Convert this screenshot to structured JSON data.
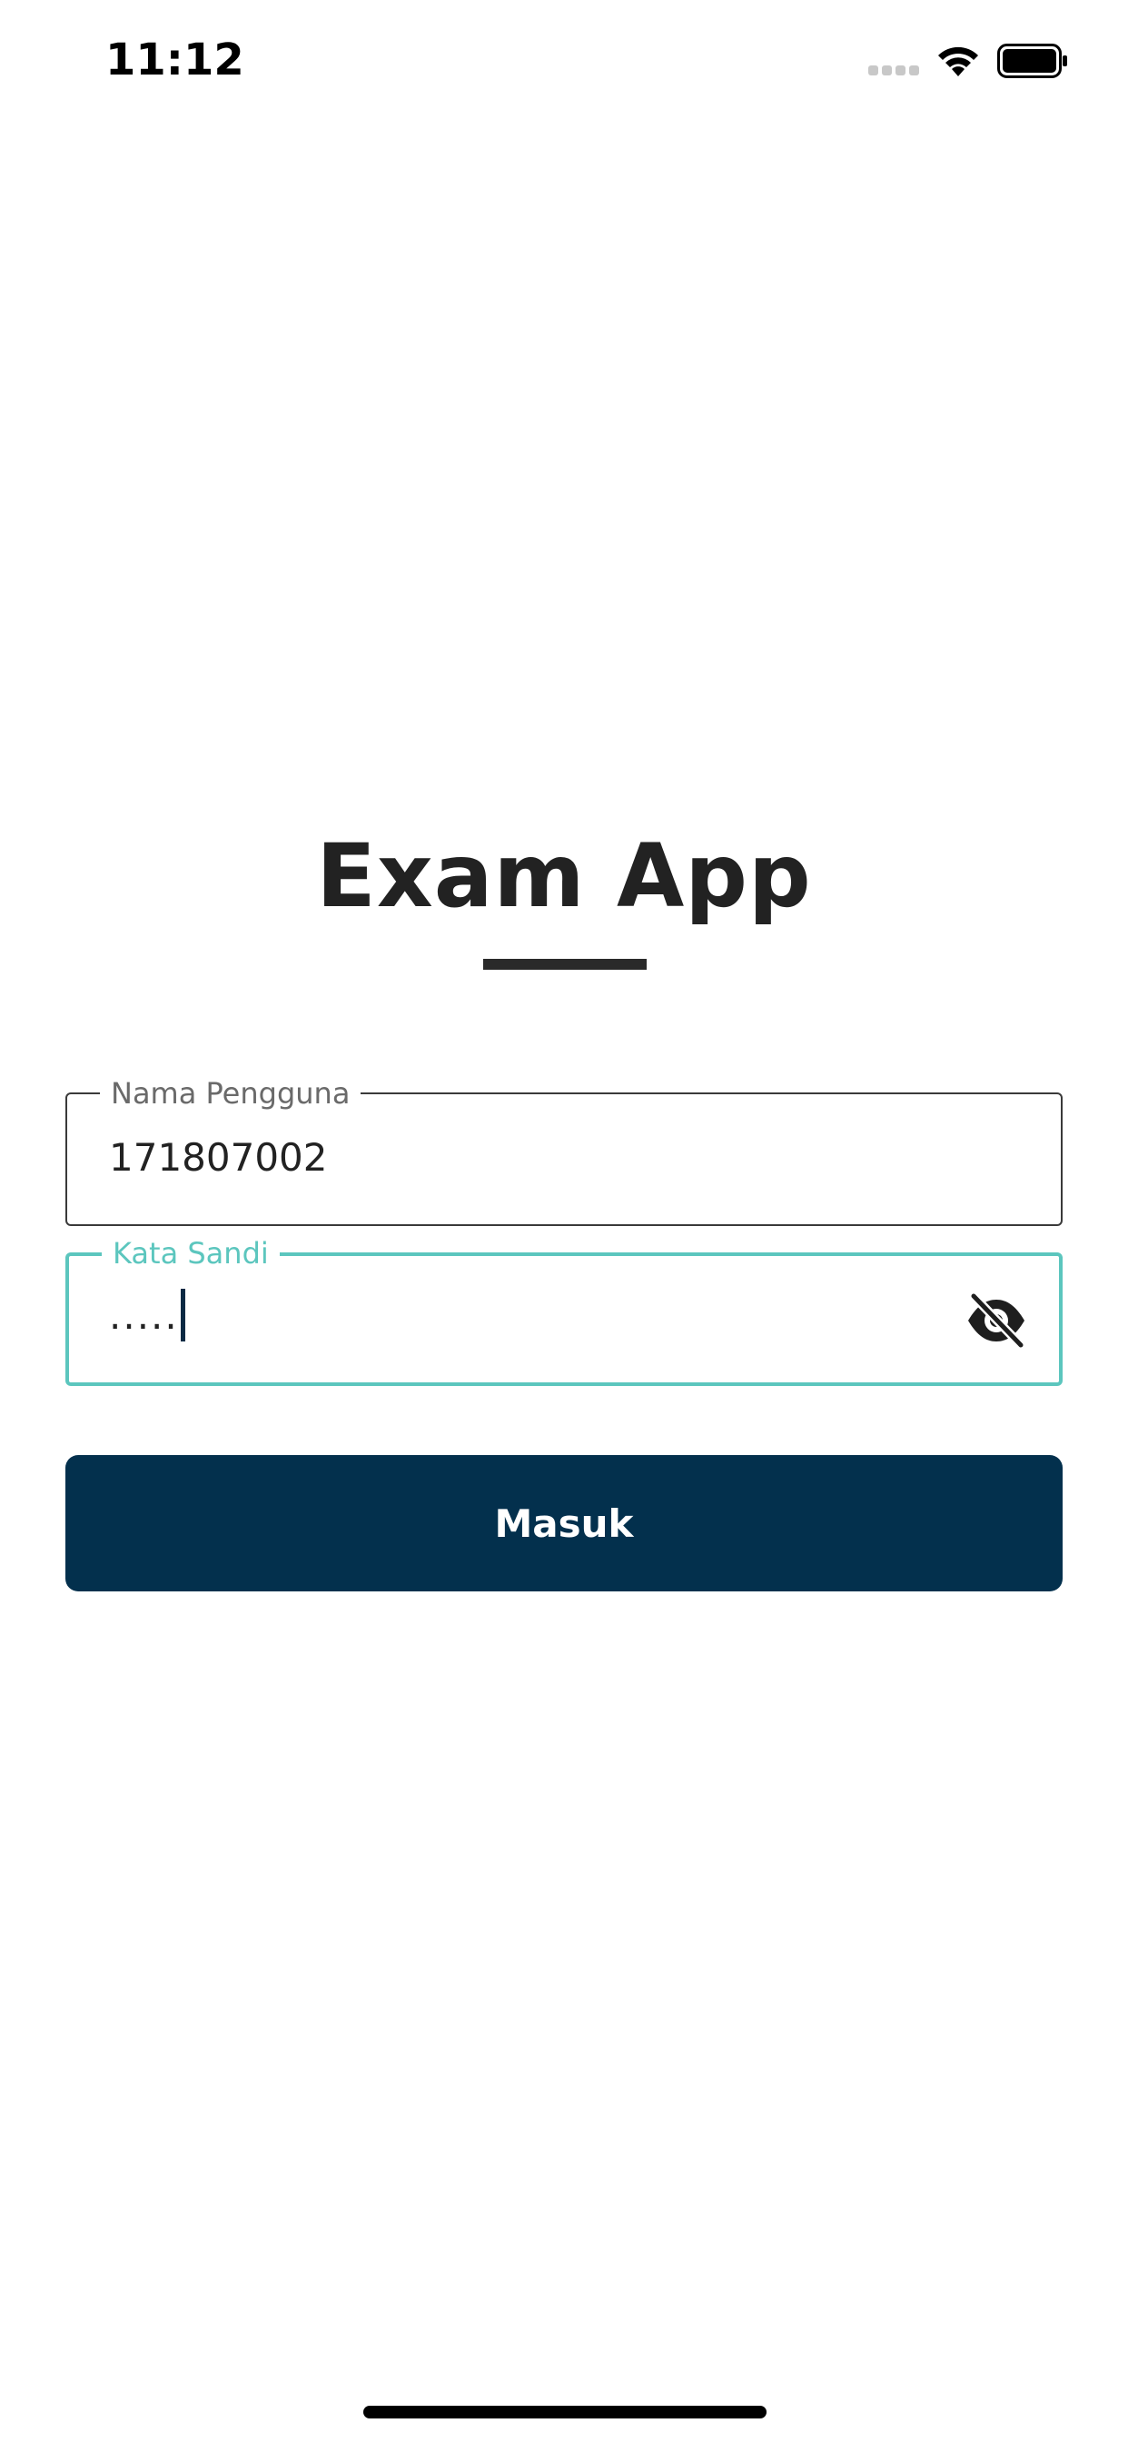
{
  "status_bar": {
    "time": "11:12",
    "icons": [
      "cellular-signal-icon",
      "wifi-icon",
      "battery-icon"
    ]
  },
  "app": {
    "title": "Exam App"
  },
  "form": {
    "username": {
      "label": "Nama Pengguna",
      "value": "171807002"
    },
    "password": {
      "label": "Kata Sandi",
      "value": ".....",
      "toggle_icon": "eye-slash-icon"
    },
    "submit_label": "Masuk"
  },
  "colors": {
    "primary": "#03304d",
    "focus_accent": "#5cc6be",
    "text": "#222222"
  }
}
